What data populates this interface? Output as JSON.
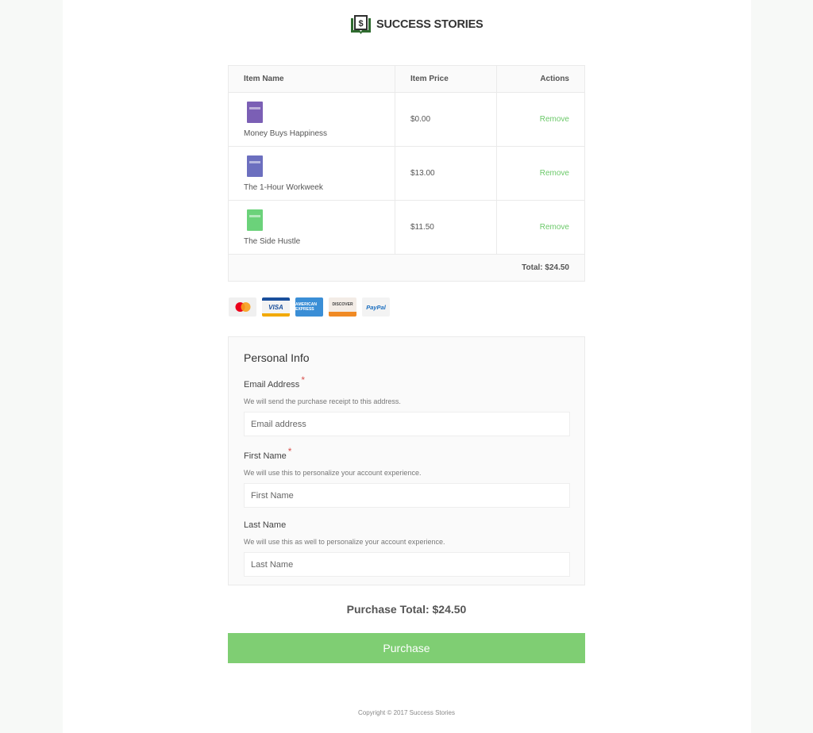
{
  "brand": {
    "name": "SUCCESS STORIES",
    "accent": "#7fce73"
  },
  "cart": {
    "headers": {
      "name": "Item Name",
      "price": "Item Price",
      "actions": "Actions"
    },
    "items": [
      {
        "name": "Money Buys Happiness",
        "price": "$0.00",
        "action": "Remove",
        "cover": "#7b5fb5"
      },
      {
        "name": "The 1-Hour Workweek",
        "price": "$13.00",
        "action": "Remove",
        "cover": "#6c6fbf"
      },
      {
        "name": "The Side Hustle",
        "price": "$11.50",
        "action": "Remove",
        "cover": "#6bd27a"
      }
    ],
    "total": "Total: $24.50"
  },
  "payment_icons": [
    "mastercard-icon",
    "visa-icon",
    "american-express-icon",
    "discover-icon",
    "paypal-icon"
  ],
  "payment_labels": {
    "visa": "VISA",
    "amex": "AMERICAN EXPRESS",
    "discover": "DISCOVER",
    "paypal": "PayPal"
  },
  "personal_info": {
    "title": "Personal Info",
    "email": {
      "label": "Email Address",
      "required": "*",
      "help": "We will send the purchase receipt to this address.",
      "placeholder": "Email address",
      "value": ""
    },
    "first_name": {
      "label": "First Name",
      "required": "*",
      "help": "We will use this to personalize your account experience.",
      "placeholder": "First Name",
      "value": ""
    },
    "last_name": {
      "label": "Last Name",
      "help": "We will use this as well to personalize your account experience.",
      "placeholder": "Last Name",
      "value": ""
    }
  },
  "purchase_total": "Purchase Total: $24.50",
  "purchase_button": "Purchase",
  "footer": {
    "copyright": "Copyright © 2017 Success Stories"
  }
}
